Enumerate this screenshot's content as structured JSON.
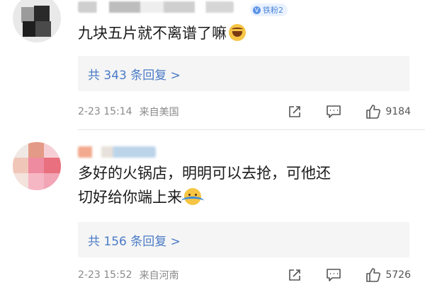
{
  "comments": [
    {
      "badge_icon": "V",
      "badge": "铁粉2",
      "text": "九块五片就不离谱了嘛",
      "emoji": "laughing-tears-emoji",
      "replies": "共 343 条回复 >",
      "date": "2-23 15:14",
      "location": "来自美国",
      "likes": "9184"
    },
    {
      "text_line1": "多好的火锅店，明明可以去抢，可他还",
      "text_line2": "切好给你端上来",
      "emoji": "shrug-emoji",
      "replies": "共 156 条回复 >",
      "date": "2-23 15:52",
      "location": "来自河南",
      "likes": "5726"
    }
  ],
  "colors": {
    "link": "#4a7bc6",
    "meta": "#8a8a8a",
    "reply_bg": "#f5f5f5"
  }
}
